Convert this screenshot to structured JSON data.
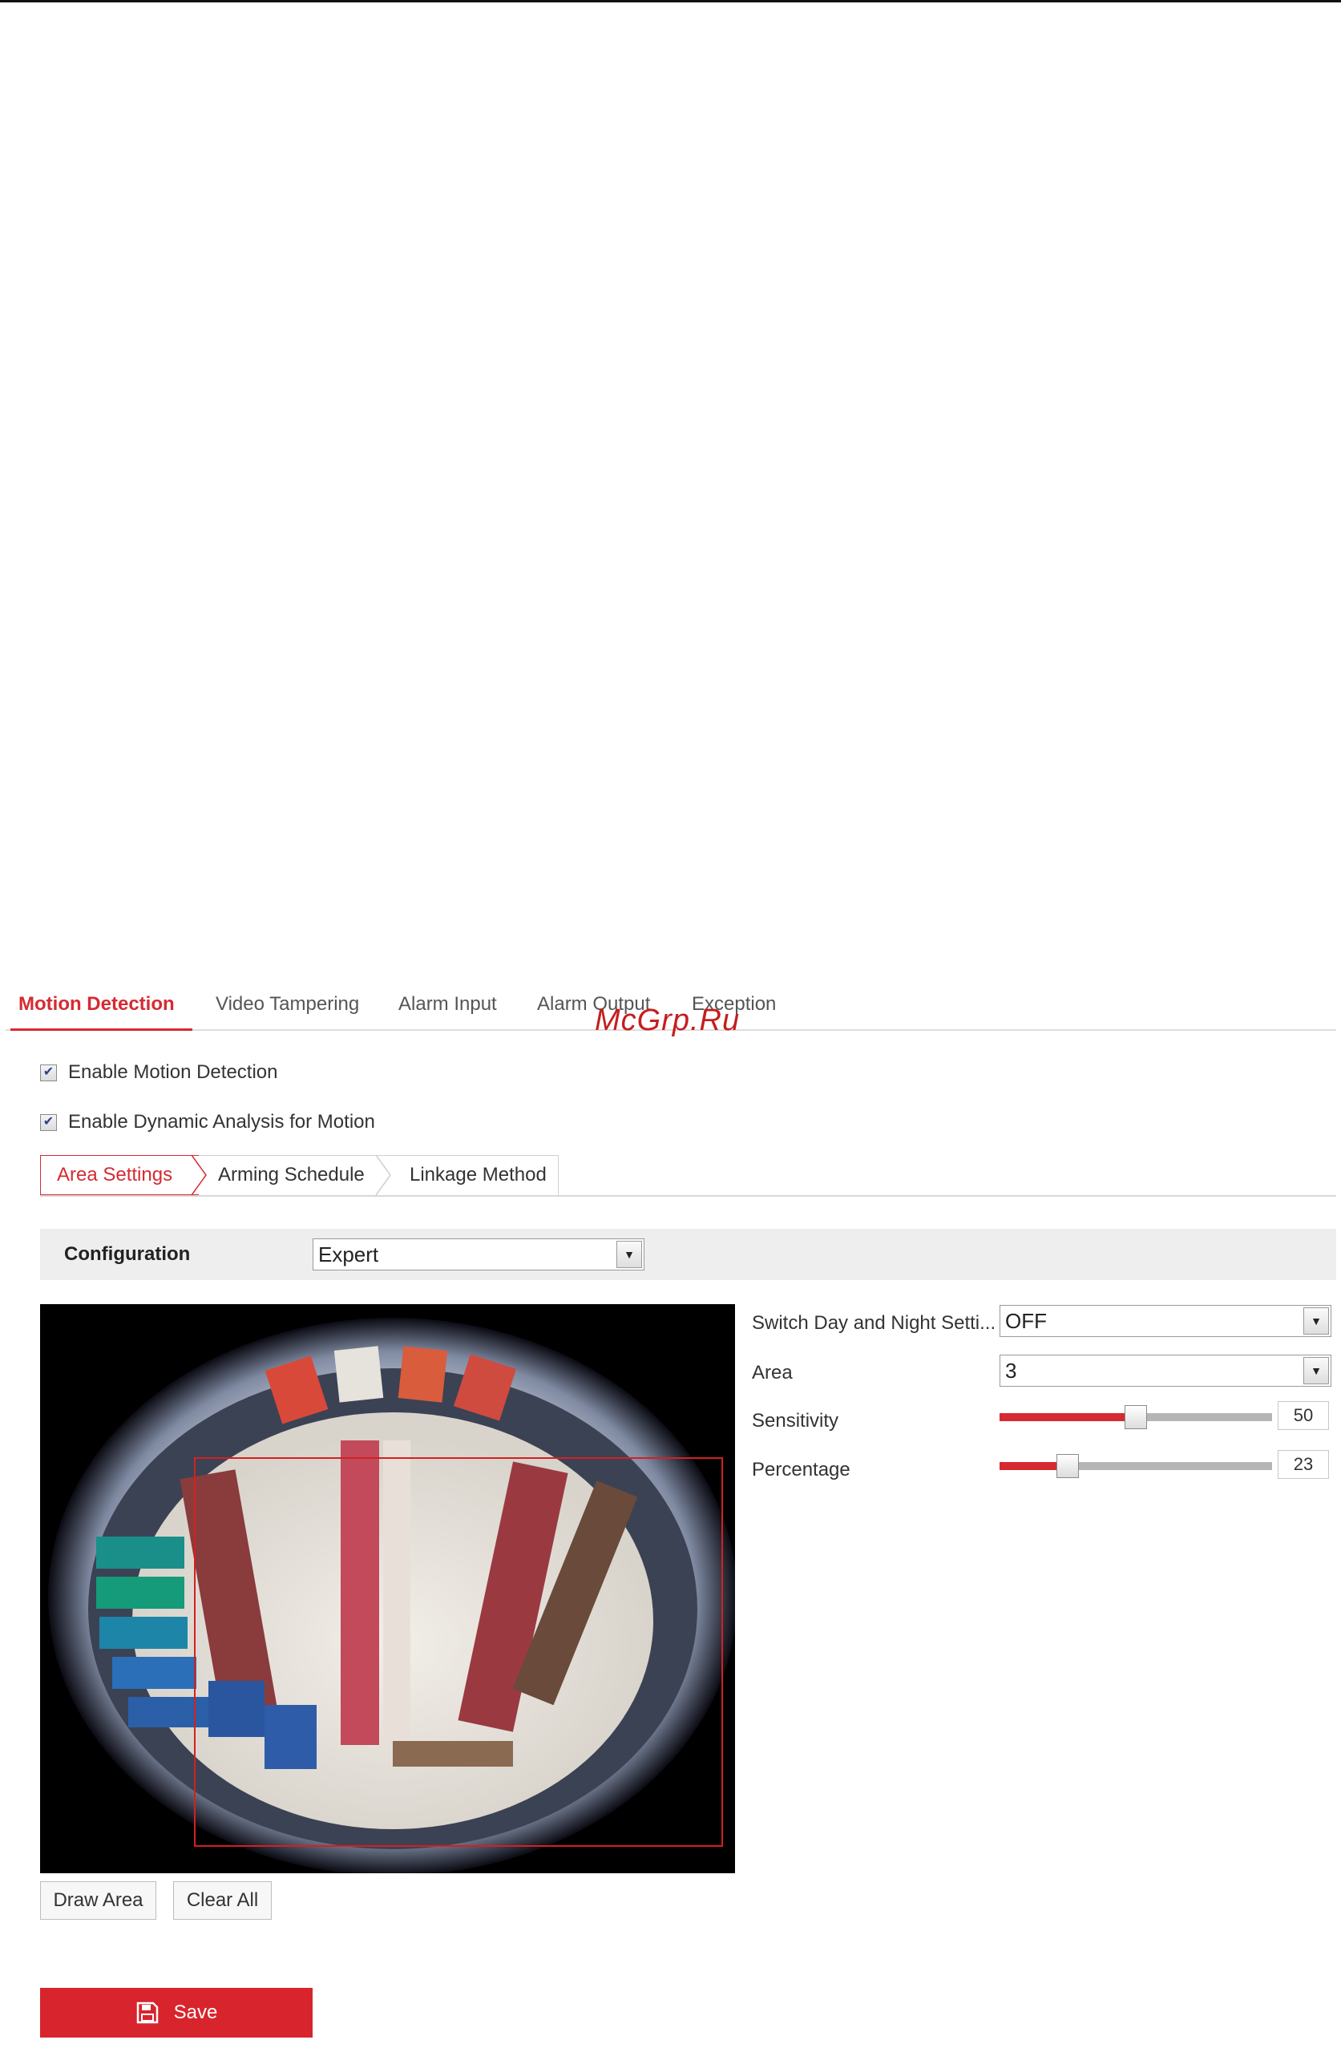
{
  "watermark": "McGrp.Ru",
  "main_tabs": [
    {
      "label": "Motion Detection",
      "active": true
    },
    {
      "label": "Video Tampering",
      "active": false
    },
    {
      "label": "Alarm Input",
      "active": false
    },
    {
      "label": "Alarm Output",
      "active": false
    },
    {
      "label": "Exception",
      "active": false
    }
  ],
  "options": {
    "enable_motion_detection": {
      "label": "Enable Motion Detection",
      "checked": true
    },
    "enable_dynamic_analysis": {
      "label": "Enable Dynamic Analysis for Motion",
      "checked": true
    }
  },
  "sub_tabs": [
    {
      "label": "Area Settings",
      "active": true
    },
    {
      "label": "Arming Schedule",
      "active": false
    },
    {
      "label": "Linkage Method",
      "active": false
    }
  ],
  "configuration": {
    "label": "Configuration",
    "value": "Expert"
  },
  "settings": {
    "switch_day_night": {
      "label": "Switch Day and Night Setti...",
      "value": "OFF"
    },
    "area": {
      "label": "Area",
      "value": "3"
    },
    "sensitivity": {
      "label": "Sensitivity",
      "value": "50",
      "fraction": 0.5
    },
    "percentage": {
      "label": "Percentage",
      "value": "23",
      "fraction": 0.25
    }
  },
  "buttons": {
    "draw_area": "Draw Area",
    "clear_all": "Clear All",
    "save": "Save"
  },
  "colors": {
    "accent": "#d62a32",
    "save_button": "#d8242c"
  },
  "icons": {
    "checkbox": "checkmark-icon",
    "dropdown": "chevron-down-icon",
    "save": "floppy-disk-icon"
  }
}
